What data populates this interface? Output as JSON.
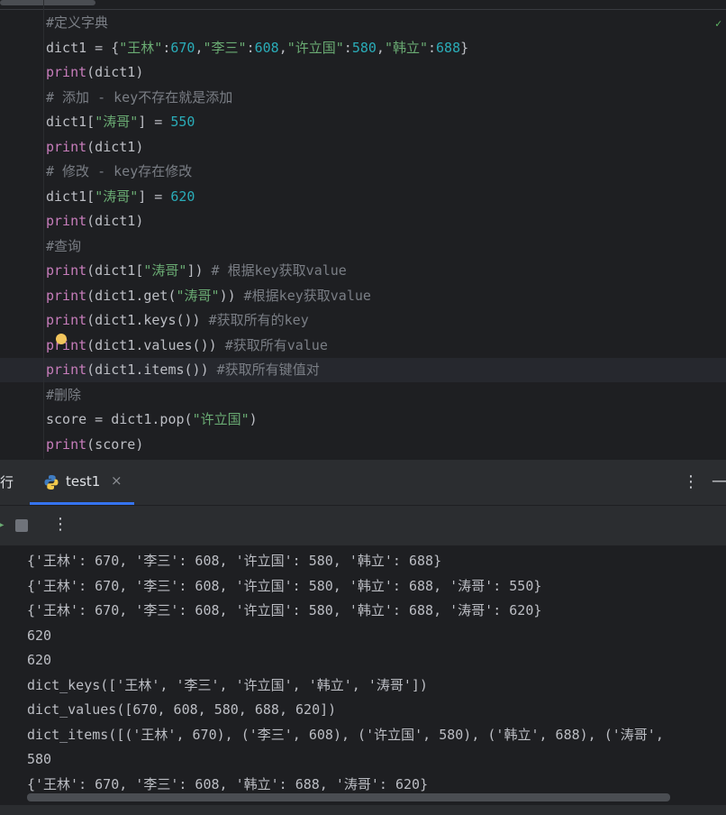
{
  "editor": {
    "lines": [
      [
        {
          "t": "#定义字典",
          "c": "cm"
        }
      ],
      [
        {
          "t": "dict1 = {",
          "c": ""
        },
        {
          "t": "\"王林\"",
          "c": "str"
        },
        {
          "t": ":",
          "c": ""
        },
        {
          "t": "670",
          "c": "num"
        },
        {
          "t": ",",
          "c": ""
        },
        {
          "t": "\"李三\"",
          "c": "str"
        },
        {
          "t": ":",
          "c": ""
        },
        {
          "t": "608",
          "c": "num"
        },
        {
          "t": ",",
          "c": ""
        },
        {
          "t": "\"许立国\"",
          "c": "str"
        },
        {
          "t": ":",
          "c": ""
        },
        {
          "t": "580",
          "c": "num"
        },
        {
          "t": ",",
          "c": ""
        },
        {
          "t": "\"韩立\"",
          "c": "str"
        },
        {
          "t": ":",
          "c": ""
        },
        {
          "t": "688",
          "c": "num"
        },
        {
          "t": "}",
          "c": ""
        }
      ],
      [
        {
          "t": "print",
          "c": "kw"
        },
        {
          "t": "(dict1)",
          "c": ""
        }
      ],
      [
        {
          "t": "# 添加 - key不存在就是添加",
          "c": "cm"
        }
      ],
      [
        {
          "t": "dict1[",
          "c": ""
        },
        {
          "t": "\"涛哥\"",
          "c": "str"
        },
        {
          "t": "] = ",
          "c": ""
        },
        {
          "t": "550",
          "c": "num"
        }
      ],
      [
        {
          "t": "print",
          "c": "kw"
        },
        {
          "t": "(dict1)",
          "c": ""
        }
      ],
      [
        {
          "t": "# 修改 - key存在修改",
          "c": "cm"
        }
      ],
      [
        {
          "t": "dict1[",
          "c": ""
        },
        {
          "t": "\"涛哥\"",
          "c": "str"
        },
        {
          "t": "] = ",
          "c": ""
        },
        {
          "t": "620",
          "c": "num"
        }
      ],
      [
        {
          "t": "print",
          "c": "kw"
        },
        {
          "t": "(dict1)",
          "c": ""
        }
      ],
      [
        {
          "t": "#查询",
          "c": "cm"
        }
      ],
      [
        {
          "t": "print",
          "c": "kw"
        },
        {
          "t": "(dict1[",
          "c": ""
        },
        {
          "t": "\"涛哥\"",
          "c": "str"
        },
        {
          "t": "]) ",
          "c": ""
        },
        {
          "t": "# 根据key获取value",
          "c": "cm"
        }
      ],
      [
        {
          "t": "print",
          "c": "kw"
        },
        {
          "t": "(dict1.get(",
          "c": ""
        },
        {
          "t": "\"涛哥\"",
          "c": "str"
        },
        {
          "t": ")) ",
          "c": ""
        },
        {
          "t": "#根据key获取value",
          "c": "cm"
        }
      ],
      [
        {
          "t": "print",
          "c": "kw"
        },
        {
          "t": "(dict1.keys()) ",
          "c": ""
        },
        {
          "t": "#获取所有的key",
          "c": "cm"
        }
      ],
      [
        {
          "t": "print",
          "c": "kw"
        },
        {
          "t": "(dict1.values()) ",
          "c": ""
        },
        {
          "t": "#获取所有value",
          "c": "cm"
        }
      ],
      [
        {
          "t": "print",
          "c": "kw"
        },
        {
          "t": "(dict1.items()) ",
          "c": ""
        },
        {
          "t": "#获取所有键值对",
          "c": "cm"
        }
      ],
      [
        {
          "t": "#删除",
          "c": "cm"
        }
      ],
      [
        {
          "t": "score = dict1.pop(",
          "c": ""
        },
        {
          "t": "\"许立国\"",
          "c": "str"
        },
        {
          "t": ")",
          "c": ""
        }
      ],
      [
        {
          "t": "print",
          "c": "kw"
        },
        {
          "t": "(score)",
          "c": ""
        }
      ]
    ]
  },
  "toolwindow": {
    "run_label": "行",
    "tab_label": "test1",
    "close_glyph": "×",
    "more_glyph": "⋮",
    "minimize_glyph": "—"
  },
  "console": {
    "toolbar_more_glyph": "⋮",
    "output": [
      "{'王林': 670, '李三': 608, '许立国': 580, '韩立': 688}",
      "{'王林': 670, '李三': 608, '许立国': 580, '韩立': 688, '涛哥': 550}",
      "{'王林': 670, '李三': 608, '许立国': 580, '韩立': 688, '涛哥': 620}",
      "620",
      "620",
      "dict_keys(['王林', '李三', '许立国', '韩立', '涛哥'])",
      "dict_values([670, 608, 580, 688, 620])",
      "dict_items([('王林', 670), ('李三', 608), ('许立国', 580), ('韩立', 688), ('涛哥', ",
      "580",
      "{'王林': 670, '李三': 608, '韩立': 688, '涛哥': 620}"
    ]
  },
  "colors": {
    "background": "#1e1f22",
    "panel": "#2b2d30",
    "keyword": "#c77dbb",
    "string": "#6aab73",
    "number": "#2aacb8",
    "comment": "#7a7e85",
    "accent": "#3574f0"
  }
}
